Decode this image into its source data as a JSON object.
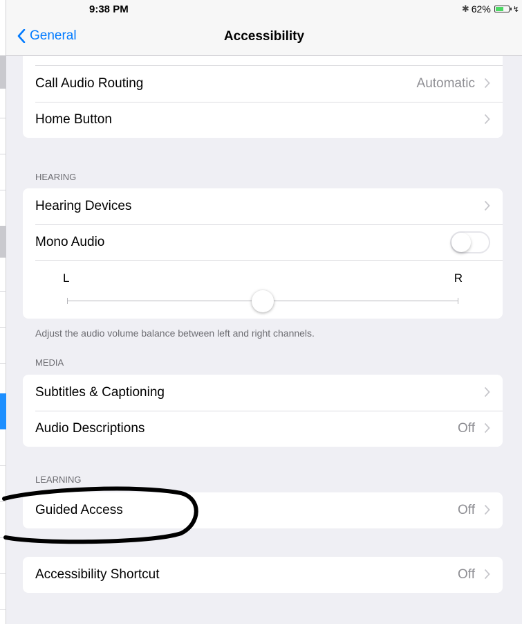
{
  "status": {
    "time": "9:38 PM",
    "battery": "62%",
    "battery_level": 0.62
  },
  "nav": {
    "back_label": "General",
    "title": "Accessibility"
  },
  "top_group": {
    "call_audio_routing": {
      "label": "Call Audio Routing",
      "value": "Automatic"
    },
    "home_button": {
      "label": "Home Button"
    }
  },
  "hearing": {
    "header": "HEARING",
    "hearing_devices": {
      "label": "Hearing Devices"
    },
    "mono_audio": {
      "label": "Mono Audio",
      "on": false
    },
    "balance": {
      "left": "L",
      "right": "R",
      "position": 0.5
    },
    "footer": "Adjust the audio volume balance between left and right channels."
  },
  "media": {
    "header": "MEDIA",
    "subtitles": {
      "label": "Subtitles & Captioning"
    },
    "audio_descriptions": {
      "label": "Audio Descriptions",
      "value": "Off"
    }
  },
  "learning": {
    "header": "LEARNING",
    "guided_access": {
      "label": "Guided Access",
      "value": "Off"
    }
  },
  "shortcut": {
    "accessibility_shortcut": {
      "label": "Accessibility Shortcut",
      "value": "Off"
    }
  },
  "colors": {
    "accent": "#007aff",
    "annotation": "#000000",
    "background": "#efeff4"
  }
}
